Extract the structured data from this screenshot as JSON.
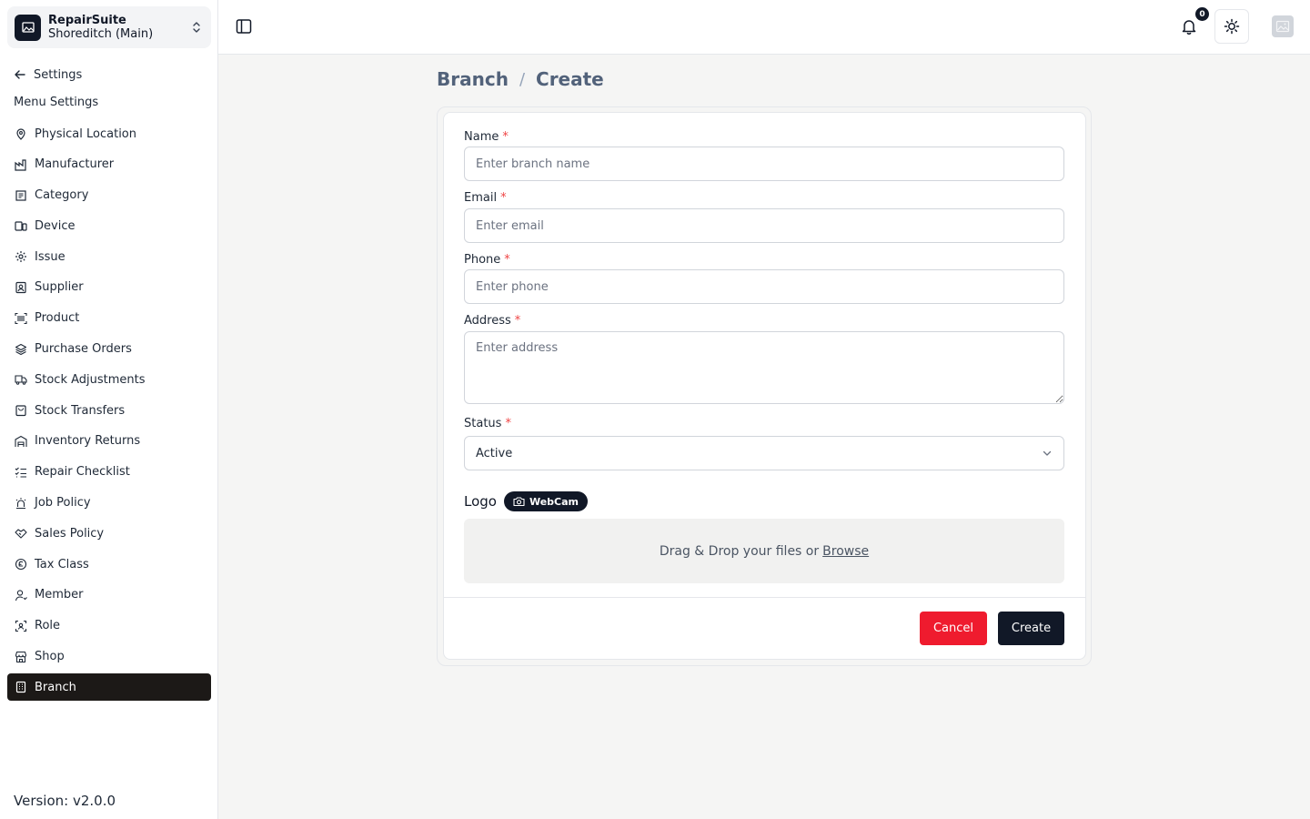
{
  "app": {
    "name": "RepairSuite",
    "branch": "Shoreditch (Main)"
  },
  "sidebar": {
    "back_label": "Settings",
    "menu_title": "Menu Settings",
    "items": [
      {
        "label": "Physical Location",
        "icon": "map-pin-icon"
      },
      {
        "label": "Manufacturer",
        "icon": "factory-icon"
      },
      {
        "label": "Category",
        "icon": "category-icon"
      },
      {
        "label": "Device",
        "icon": "devices-icon"
      },
      {
        "label": "Issue",
        "icon": "gear-icon"
      },
      {
        "label": "Supplier",
        "icon": "supplier-icon"
      },
      {
        "label": "Product",
        "icon": "barcode-icon"
      },
      {
        "label": "Purchase Orders",
        "icon": "layers-icon"
      },
      {
        "label": "Stock Adjustments",
        "icon": "truck-icon"
      },
      {
        "label": "Stock Transfers",
        "icon": "bag-icon"
      },
      {
        "label": "Inventory Returns",
        "icon": "warehouse-icon"
      },
      {
        "label": "Repair Checklist",
        "icon": "checklist-icon"
      },
      {
        "label": "Job Policy",
        "icon": "siren-icon"
      },
      {
        "label": "Sales Policy",
        "icon": "handshake-icon"
      },
      {
        "label": "Tax Class",
        "icon": "coin-icon"
      },
      {
        "label": "Member",
        "icon": "user-icon"
      },
      {
        "label": "Role",
        "icon": "role-icon"
      },
      {
        "label": "Shop",
        "icon": "store-icon"
      },
      {
        "label": "Branch",
        "icon": "building-icon",
        "active": true
      }
    ],
    "version": "Version: v2.0.0"
  },
  "header": {
    "notification_count": "0"
  },
  "breadcrumb": {
    "parent": "Branch",
    "separator": "/",
    "current": "Create"
  },
  "form": {
    "name": {
      "label": "Name",
      "required": "*",
      "placeholder": "Enter branch name",
      "value": ""
    },
    "email": {
      "label": "Email",
      "required": "*",
      "placeholder": "Enter email",
      "value": ""
    },
    "phone": {
      "label": "Phone",
      "required": "*",
      "placeholder": "Enter phone",
      "value": ""
    },
    "address": {
      "label": "Address",
      "required": "*",
      "placeholder": "Enter address",
      "value": ""
    },
    "status": {
      "label": "Status",
      "required": "*",
      "value": "Active"
    },
    "logo": {
      "label": "Logo",
      "webcam_label": "WebCam",
      "drop_text": "Drag & Drop your files or",
      "browse_label": "Browse"
    },
    "cancel_label": "Cancel",
    "create_label": "Create"
  },
  "colors": {
    "accent": "#111827",
    "danger": "#ef1b2e",
    "active_nav": "#1c1917",
    "breadcrumb": "#52627a"
  }
}
